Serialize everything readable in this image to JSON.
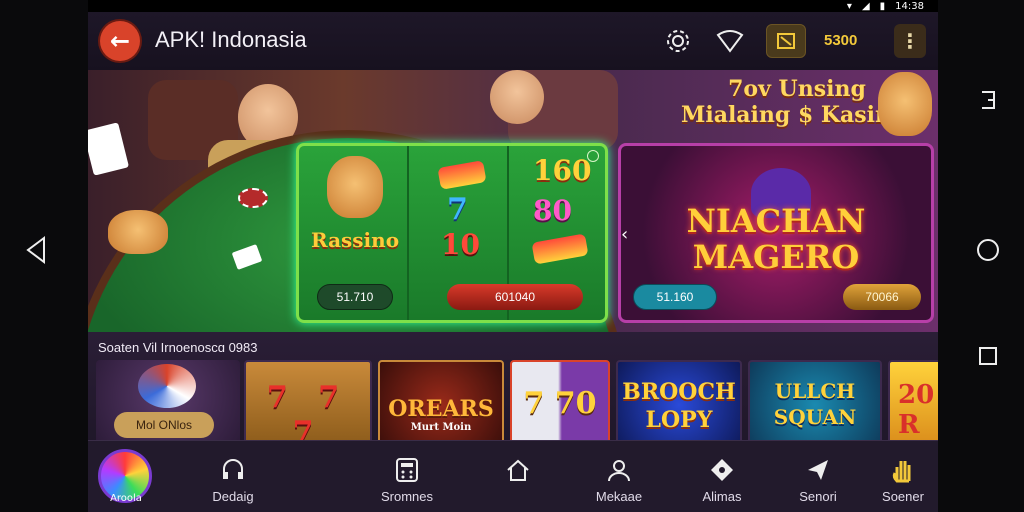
{
  "status": {
    "time": "14:38"
  },
  "header": {
    "title": "APK! Indonasia",
    "coins": "5300"
  },
  "hero": {
    "headline_line1": "7ov Unsing",
    "headline_line2": "Mialaing $ Kasimo",
    "slot": {
      "logo": "Rassino",
      "reel_values": [
        "7",
        "10",
        "160",
        "80"
      ],
      "pill_left": "51.710",
      "pill_right": "601040"
    },
    "promo": {
      "title_line1": "NIACHAN",
      "title_line2": "MAGERO",
      "pill_left": "51.160",
      "pill_right": "70066"
    }
  },
  "strip": {
    "label": "Soaten Vil Irnoenoscɑ 0983",
    "tiles": [
      {
        "label": "Mol ONlos"
      },
      {
        "label": "7 7 7"
      },
      {
        "label": "OREARS",
        "sub": "Murt Moin"
      },
      {
        "label": "7 70"
      },
      {
        "label": "BROOCH LOPY"
      },
      {
        "label": "ULLCH SQUAN"
      },
      {
        "label": "20 R"
      }
    ]
  },
  "bottom_nav": {
    "items": [
      {
        "label": "Aroola",
        "icon": "home-orb-icon"
      },
      {
        "label": "Dedaig",
        "icon": "headset-icon"
      },
      {
        "label": "Sromnes",
        "icon": "calculator-icon"
      },
      {
        "label": "",
        "icon": "house-icon"
      },
      {
        "label": "Mekaae",
        "icon": "user-icon"
      },
      {
        "label": "Alimas",
        "icon": "tag-icon"
      },
      {
        "label": "Senori",
        "icon": "send-icon"
      },
      {
        "label": "Soener",
        "icon": "hand-icon"
      }
    ]
  },
  "colors": {
    "accent": "#d9432a",
    "coin": "#f3c93a",
    "panel_green": "#7ee04a",
    "panel_magenta": "#b73fa8"
  }
}
